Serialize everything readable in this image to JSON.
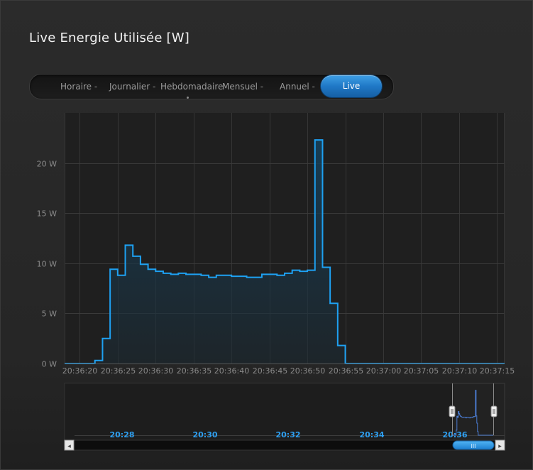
{
  "title": "Live Energie Utilisée [W]",
  "tabs": [
    {
      "label": "Horaire -",
      "active": false
    },
    {
      "label": "Journalier -",
      "active": false
    },
    {
      "label": "Hebdomadaire",
      "active": false
    },
    {
      "label": "Mensuel -",
      "active": false
    },
    {
      "label": "Annuel -",
      "active": false
    },
    {
      "label": "Live",
      "active": true
    }
  ],
  "colors": {
    "line": "#1ea1f2",
    "accent": "#1f78c6",
    "navigator_labels": "#2e9ff0"
  },
  "chart_data": {
    "type": "area",
    "title": "",
    "xlabel": "",
    "ylabel": "",
    "step": true,
    "ylim": [
      0,
      25
    ],
    "yticks": [
      {
        "value": 0,
        "label": "0 W"
      },
      {
        "value": 5,
        "label": "5 W"
      },
      {
        "value": 10,
        "label": "10 W"
      },
      {
        "value": 15,
        "label": "15 W"
      },
      {
        "value": 20,
        "label": "20 W"
      }
    ],
    "xticks": [
      "20:36:20",
      "20:36:25",
      "20:36:30",
      "20:36:35",
      "20:36:40",
      "20:36:45",
      "20:36:50",
      "20:36:55",
      "20:37:00",
      "20:37:05",
      "20:37:10",
      "20:37:15"
    ],
    "x_start": "20:36:18",
    "x_end": "20:37:16",
    "x_step_seconds": 1,
    "grid": true,
    "legend": "none",
    "series": [
      {
        "name": "",
        "values": [
          0,
          0,
          0,
          0,
          0.3,
          2.5,
          9.4,
          8.8,
          11.8,
          10.7,
          9.9,
          9.4,
          9.2,
          9.0,
          8.9,
          9.0,
          8.9,
          8.9,
          8.8,
          8.6,
          8.8,
          8.8,
          8.7,
          8.7,
          8.6,
          8.6,
          8.9,
          8.9,
          8.8,
          9.0,
          9.3,
          9.2,
          9.3,
          22.3,
          9.6,
          6.0,
          1.8,
          0,
          0,
          0,
          0,
          0,
          0,
          0,
          0,
          0,
          0,
          0,
          0,
          0,
          0,
          0,
          0,
          0,
          0,
          0,
          0,
          0,
          0
        ]
      }
    ]
  },
  "navigator": {
    "labels": [
      "20:28",
      "20:30",
      "20:32",
      "20:34",
      "20:36"
    ],
    "scroll_left": "◂",
    "scroll_right": "▸",
    "thumb_grip": "III"
  }
}
